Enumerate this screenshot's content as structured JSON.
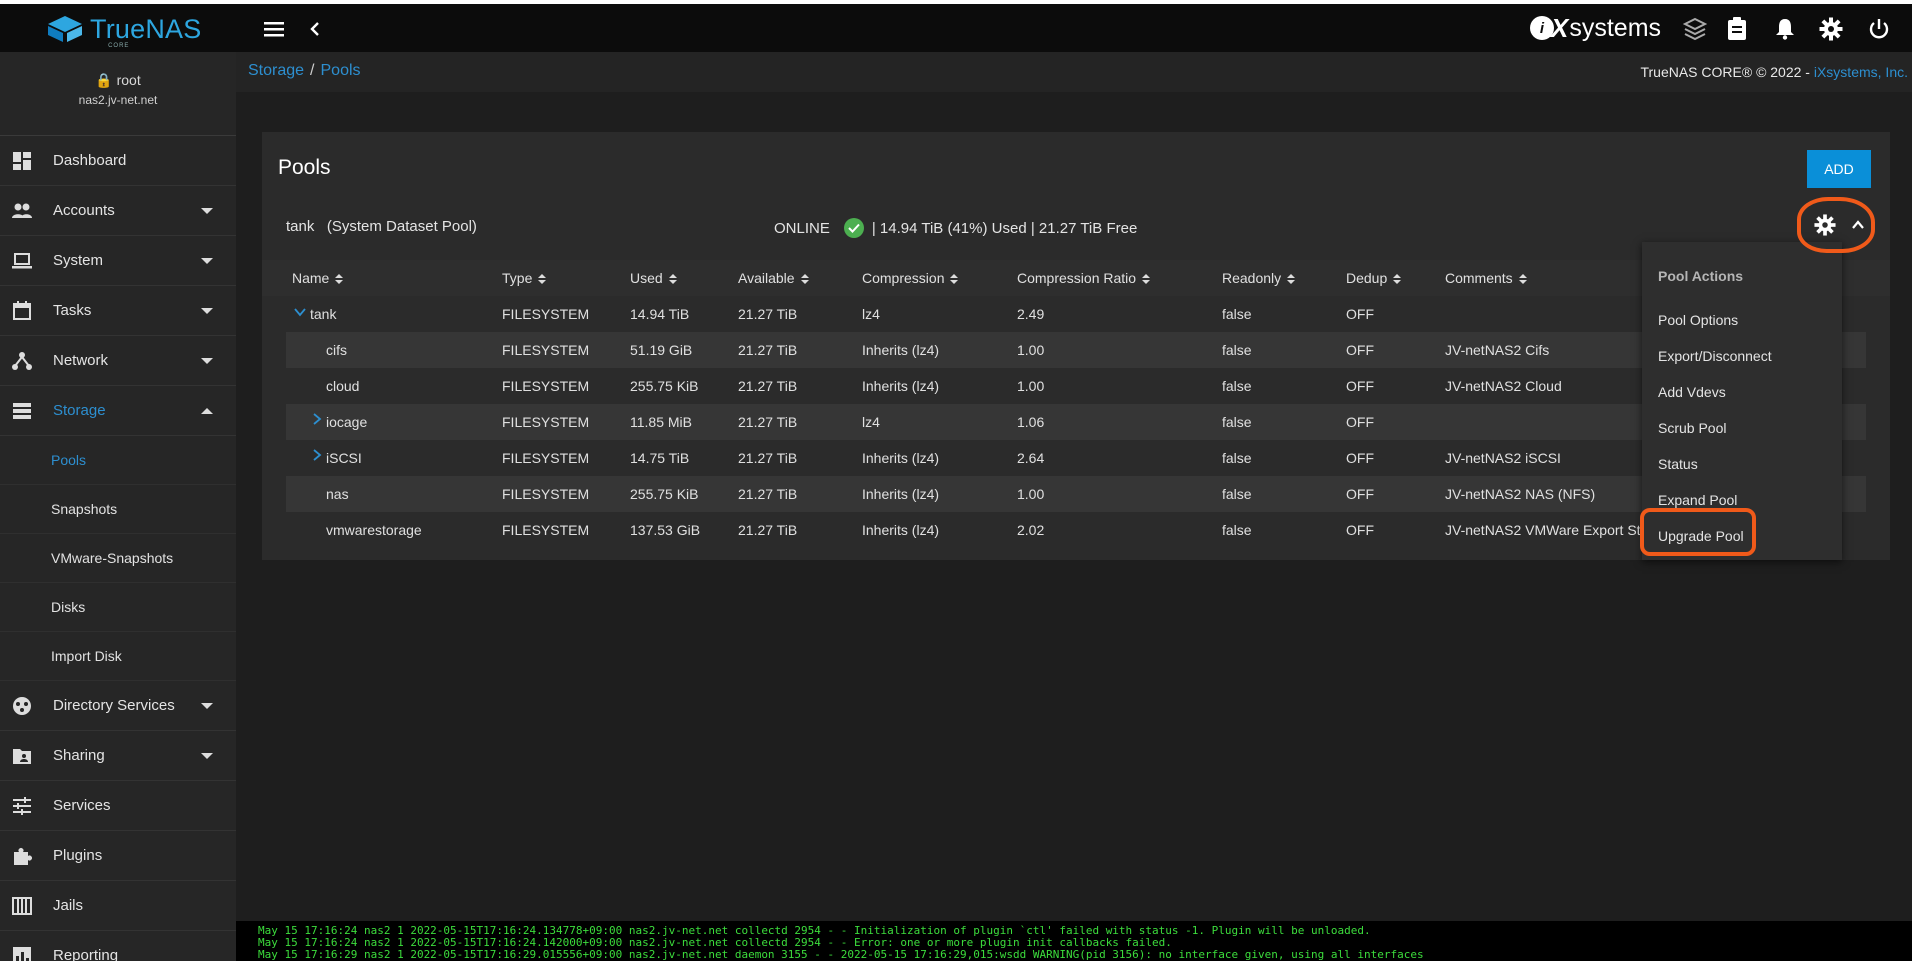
{
  "topbar": {
    "brand": "TrueNAS",
    "brand_sub": "CORE",
    "vendor": "systems",
    "icons": [
      "menu-icon",
      "back-icon",
      "layers-icon",
      "clipboard-icon",
      "bell-icon",
      "gear-icon",
      "power-icon"
    ]
  },
  "user": {
    "name": "root",
    "host": "nas2.jv-net.net"
  },
  "sidebar": {
    "items": [
      {
        "label": "Dashboard"
      },
      {
        "label": "Accounts"
      },
      {
        "label": "System"
      },
      {
        "label": "Tasks"
      },
      {
        "label": "Network"
      },
      {
        "label": "Storage"
      },
      {
        "label": "Directory Services"
      },
      {
        "label": "Sharing"
      },
      {
        "label": "Services"
      },
      {
        "label": "Plugins"
      },
      {
        "label": "Jails"
      },
      {
        "label": "Reporting"
      }
    ],
    "storage_sub": [
      {
        "label": "Pools"
      },
      {
        "label": "Snapshots"
      },
      {
        "label": "VMware-Snapshots"
      },
      {
        "label": "Disks"
      },
      {
        "label": "Import Disk"
      }
    ]
  },
  "breadcrumb": {
    "parent": "Storage",
    "sep": "/",
    "current": "Pools"
  },
  "copyright": {
    "text": "TrueNAS CORE® © 2022 - ",
    "link": "iXsystems, Inc."
  },
  "card": {
    "title": "Pools",
    "add_label": "ADD",
    "pool_name": "tank",
    "pool_note": "(System Dataset Pool)",
    "status": "ONLINE",
    "usage": "| 14.94 TiB (41%) Used  |  21.27 TiB Free"
  },
  "table": {
    "columns": [
      "Name",
      "Type",
      "Used",
      "Available",
      "Compression",
      "Compression Ratio",
      "Readonly",
      "Dedup",
      "Comments"
    ],
    "rows": [
      {
        "name": "tank",
        "type": "FILESYSTEM",
        "used": "14.94 TiB",
        "avail": "21.27 TiB",
        "comp": "lz4",
        "ratio": "2.49",
        "ro": "false",
        "dedup": "OFF",
        "comment": ""
      },
      {
        "name": "cifs",
        "type": "FILESYSTEM",
        "used": "51.19 GiB",
        "avail": "21.27 TiB",
        "comp": "Inherits (lz4)",
        "ratio": "1.00",
        "ro": "false",
        "dedup": "OFF",
        "comment": "JV-netNAS2 Cifs"
      },
      {
        "name": "cloud",
        "type": "FILESYSTEM",
        "used": "255.75 KiB",
        "avail": "21.27 TiB",
        "comp": "Inherits (lz4)",
        "ratio": "1.00",
        "ro": "false",
        "dedup": "OFF",
        "comment": "JV-netNAS2 Cloud"
      },
      {
        "name": "iocage",
        "type": "FILESYSTEM",
        "used": "11.85 MiB",
        "avail": "21.27 TiB",
        "comp": "lz4",
        "ratio": "1.06",
        "ro": "false",
        "dedup": "OFF",
        "comment": ""
      },
      {
        "name": "iSCSI",
        "type": "FILESYSTEM",
        "used": "14.75 TiB",
        "avail": "21.27 TiB",
        "comp": "Inherits (lz4)",
        "ratio": "2.64",
        "ro": "false",
        "dedup": "OFF",
        "comment": "JV-netNAS2 iSCSI"
      },
      {
        "name": "nas",
        "type": "FILESYSTEM",
        "used": "255.75 KiB",
        "avail": "21.27 TiB",
        "comp": "Inherits (lz4)",
        "ratio": "1.00",
        "ro": "false",
        "dedup": "OFF",
        "comment": "JV-netNAS2 NAS (NFS)"
      },
      {
        "name": "vmwarestorage",
        "type": "FILESYSTEM",
        "used": "137.53 GiB",
        "avail": "21.27 TiB",
        "comp": "Inherits (lz4)",
        "ratio": "2.02",
        "ro": "false",
        "dedup": "OFF",
        "comment": "JV-netNAS2 VMWare Export St"
      }
    ]
  },
  "menu": {
    "header": "Pool Actions",
    "items": [
      "Pool Options",
      "Export/Disconnect",
      "Add Vdevs",
      "Scrub Pool",
      "Status",
      "Expand Pool",
      "Upgrade Pool"
    ]
  },
  "console": {
    "lines": [
      "May 15 17:16:24 nas2 1 2022-05-15T17:16:24.134778+09:00 nas2.jv-net.net collectd 2954 - - Initialization of plugin `ctl' failed with status -1. Plugin will be unloaded.",
      "May 15 17:16:24 nas2 1 2022-05-15T17:16:24.142000+09:00 nas2.jv-net.net collectd 2954 - - Error: one or more plugin init callbacks failed.",
      "May 15 17:16:29 nas2 1 2022-05-15T17:16:29.015556+09:00 nas2.jv-net.net daemon 3155 - - 2022-05-15 17:16:29,015:wsdd WARNING(pid 3156): no interface given, using all interfaces"
    ]
  },
  "colors": {
    "accent": "#2d8fd0",
    "add_button": "#0a8fd8",
    "online": "#4caf50",
    "annotation": "#f05a1a",
    "console_text": "#3cdc3c"
  }
}
